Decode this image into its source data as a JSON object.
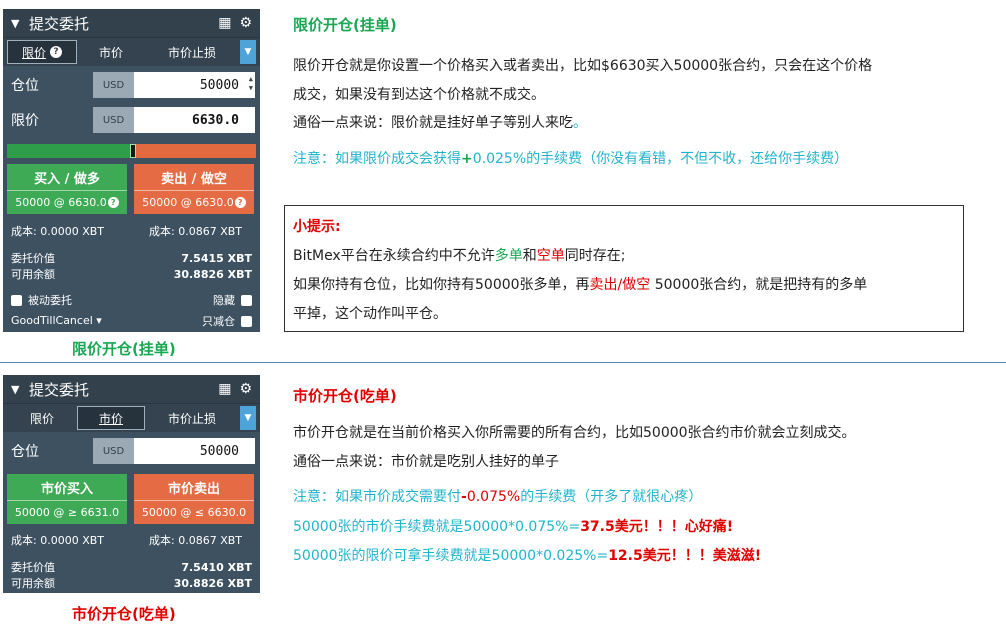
{
  "panel1": {
    "title": "提交委托",
    "tabs": [
      "限价",
      "市价",
      "市价止损"
    ],
    "active_tab": 0,
    "position_label": "仓位",
    "position_currency": "USD",
    "position_value": "50000",
    "price_label": "限价",
    "price_currency": "USD",
    "price_value": "6630.0",
    "buy_label": "买入 / 做多",
    "buy_sub": "50000 @ 6630.0",
    "sell_label": "卖出 / 做空",
    "sell_sub": "50000 @ 6630.0",
    "cost_buy": "成本: 0.0000 XBT",
    "cost_sell": "成本: 0.0867 XBT",
    "order_value_label": "委托价值",
    "order_value": "7.5415 XBT",
    "available_label": "可用余额",
    "available": "30.8826 XBT",
    "passive_label": "被动委托",
    "hidden_label": "隐藏",
    "tif_label": "GoodTillCancel",
    "reduce_label": "只减仓",
    "caption": "限价开仓(挂单)"
  },
  "panel2": {
    "title": "提交委托",
    "tabs": [
      "限价",
      "市价",
      "市价止损"
    ],
    "active_tab": 1,
    "position_label": "仓位",
    "position_currency": "USD",
    "position_value": "50000",
    "buy_label": "市价买入",
    "buy_sub": "50000 @ ≥ 6631.0",
    "sell_label": "市价卖出",
    "sell_sub": "50000 @ ≤ 6630.0",
    "cost_buy": "成本: 0.0000 XBT",
    "cost_sell": "成本: 0.0867 XBT",
    "order_value_label": "委托价值",
    "order_value": "7.5410 XBT",
    "available_label": "可用余额",
    "available": "30.8826 XBT",
    "caption": "市价开仓(吃单)"
  },
  "limit_section": {
    "heading": "限价开仓(挂单)",
    "p1_line1": "限价开仓就是你设置一个价格买入或者卖出，比如$6630买入50000张合约，只会在这个价格",
    "p1_line2": "成交，如果没有到达这个价格就不成交。",
    "p2_main": "通俗一点来说：限价就是挂好单子等别人来吃",
    "p2_end": "。",
    "note_a": "注意：如果限价成交会获得",
    "note_plus": "+",
    "note_b": "0.025%的手续费（你没有看错，不但不收，还给你手续费）"
  },
  "tip": {
    "title": "小提示:",
    "l1_a": "BitMex平台在永续合约中不允许",
    "l1_long": "多单",
    "l1_and": "和",
    "l1_short": "空单",
    "l1_b": "同时存在;",
    "l2_a": "如果你持有仓位，比如你持有50000张多单，再",
    "l2_red": "卖出/做空",
    "l2_b": " 50000张合约，就是把持有的多单",
    "l3": "平掉，这个动作叫平仓。"
  },
  "market_section": {
    "heading": "市价开仓(吃单)",
    "p1": "市价开仓就是在当前价格买入你所需要的所有合约，比如50000张合约市价就会立刻成交。",
    "p2": "通俗一点来说：市价就是吃别人挂好的单子",
    "note_a": "注意：如果市价成交需要付",
    "note_minus": "-",
    "note_pct": "0.075%",
    "note_b": "的手续费（开多了就很心疼）",
    "fee1_a": "50000张的市价手续费就是50000*0.075%=",
    "fee1_b": "37.5美元！！！心好痛!",
    "fee2_a": "50000张的限价可拿手续费就是50000*0.025%=",
    "fee2_b": "12.5美元！！！美滋滋!"
  },
  "colors": {
    "panel_bg": "#3e5161",
    "buy_green": "#3eaa56",
    "sell_orange": "#e46b44",
    "heading_green": "#1aa752",
    "heading_red": "#e00000",
    "note_cyan": "#22b3cc"
  }
}
